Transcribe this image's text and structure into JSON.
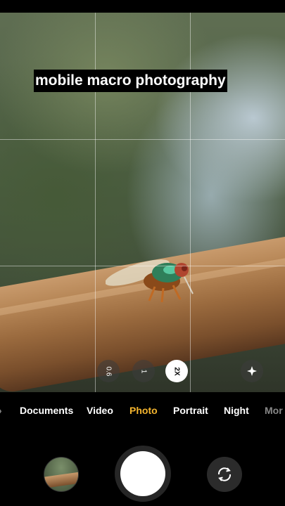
{
  "overlay": {
    "caption": "mobile macro photography"
  },
  "zoom": {
    "options": [
      {
        "label": "0.6",
        "active": false
      },
      {
        "label": "1",
        "active": false
      },
      {
        "label": "2X",
        "active": true
      }
    ],
    "effects_icon": "sparkle-icon"
  },
  "modes": {
    "items": [
      "Documents",
      "Video",
      "Photo",
      "Portrait",
      "Night",
      "Mor"
    ],
    "selected": "Photo",
    "partial_left": "›"
  },
  "controls": {
    "gallery_icon": "gallery-thumbnail",
    "shutter_icon": "shutter-button",
    "switch_icon": "switch-camera-icon"
  },
  "colors": {
    "selected_mode": "#f5b52e",
    "background": "#000000"
  }
}
